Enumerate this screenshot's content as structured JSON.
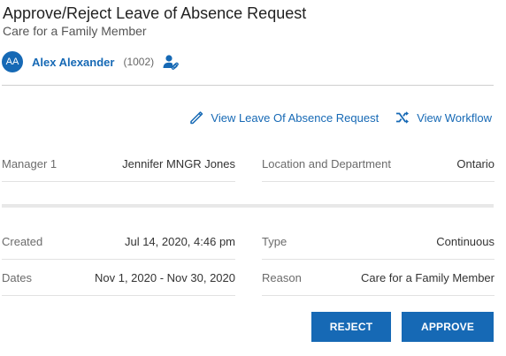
{
  "header": {
    "title": "Approve/Reject Leave of Absence Request",
    "subtitle": "Care for a Family Member"
  },
  "employee": {
    "initials": "AA",
    "name": "Alex Alexander",
    "id": "(1002)",
    "icon": "person-link-icon"
  },
  "links": {
    "view_request": "View Leave Of Absence Request",
    "view_request_icon": "pencil-icon",
    "view_workflow": "View Workflow",
    "view_workflow_icon": "shuffle-icon"
  },
  "details": {
    "manager": {
      "label": "Manager 1",
      "value": "Jennifer MNGR Jones"
    },
    "location": {
      "label": "Location and Department",
      "value": "Ontario"
    },
    "created": {
      "label": "Created",
      "value": "Jul 14, 2020, 4:46 pm"
    },
    "type": {
      "label": "Type",
      "value": "Continuous"
    },
    "dates": {
      "label": "Dates",
      "value": "Nov 1, 2020 - Nov 30, 2020"
    },
    "reason": {
      "label": "Reason",
      "value": "Care for a Family Member"
    }
  },
  "actions": {
    "reject": "REJECT",
    "approve": "APPROVE"
  },
  "colors": {
    "accent": "#1669b5",
    "divider": "#cfcfcf"
  }
}
